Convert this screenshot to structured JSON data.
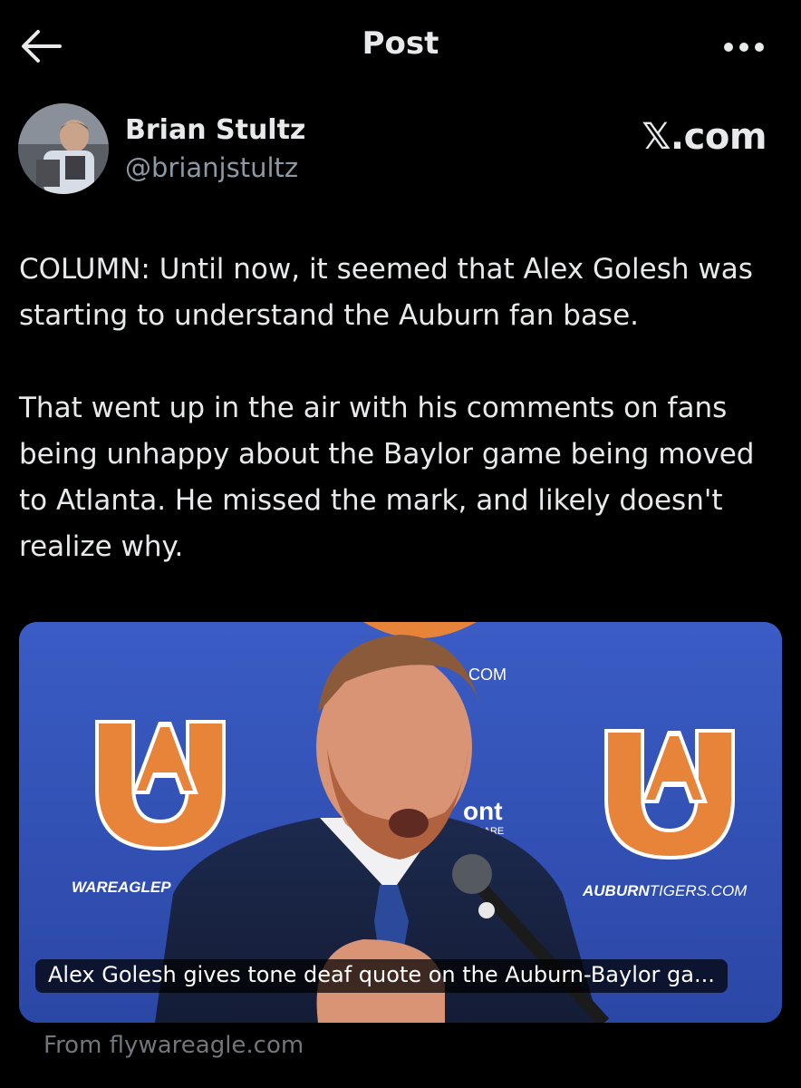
{
  "header": {
    "title": "Post",
    "back_icon": "arrow-left-icon",
    "more_icon": "more-horizontal-icon"
  },
  "author": {
    "name": "Brian Stultz",
    "handle": "@brianjstultz",
    "source_label": "𝕏.com"
  },
  "post": {
    "paragraphs": [
      "COLUMN: Until now, it seemed that Alex Golesh was starting to understand the Auburn fan base.",
      "That went up in the air with his comments on fans being unhappy about the Baylor game being moved to Atlanta. He missed the mark, and likely doesn't realize why."
    ]
  },
  "link_card": {
    "caption": "Alex Golesh gives tone deaf quote on the Auburn-Baylor ga...",
    "source": "From flywareagle.com",
    "backdrop_left_text": "WAREAGLEP",
    "backdrop_right_text_bold": "AUBURN",
    "backdrop_right_text_light": "TIGERS.COM",
    "backdrop_top_text": "COM",
    "backdrop_mid_text": "ont",
    "backdrop_mid_sub": "THCARE",
    "logo_text": "AU"
  },
  "colors": {
    "background": "#000000",
    "text": "#e7e9ea",
    "secondary": "#8b98a5",
    "backdrop_blue": "#2f4fb3",
    "auburn_orange": "#e8833a"
  }
}
